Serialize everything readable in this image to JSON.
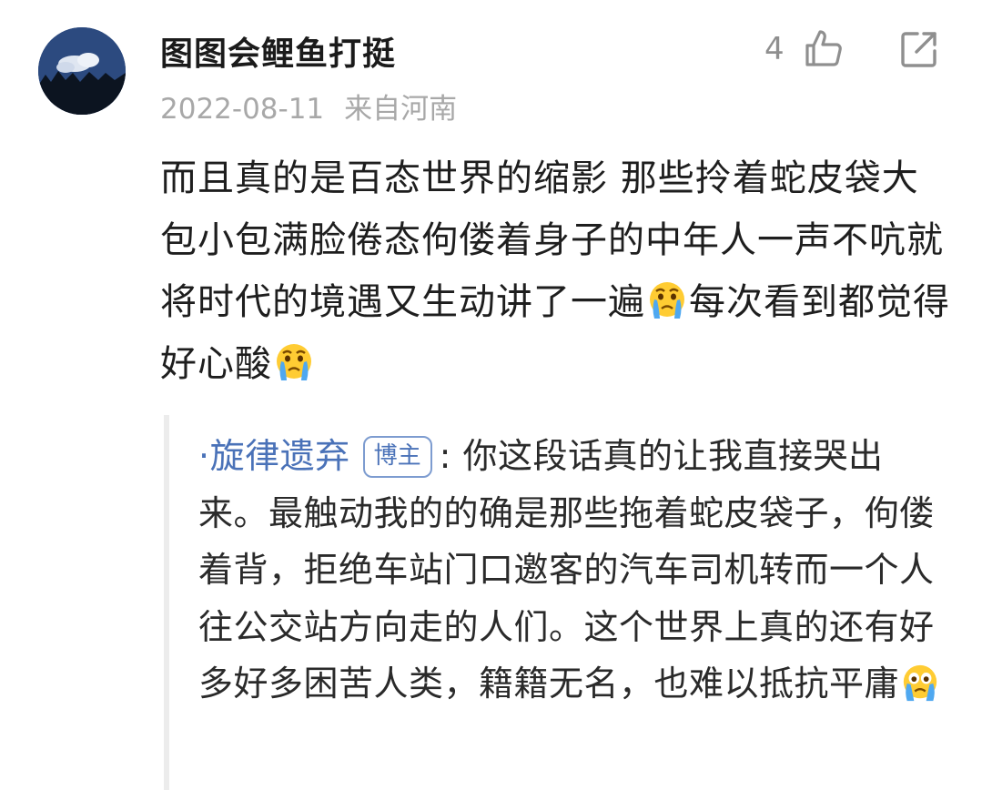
{
  "comment": {
    "username": "图图会鲤鱼打挺",
    "date": "2022-08-11",
    "location": "来自河南",
    "like_count": "4",
    "text_part1": "而且真的是百态世界的缩影 那些拎着蛇皮袋大包小包满脸倦态佝偻着身子的中年人一声不吭就将时代的境遇又生动讲了一遍",
    "text_part2": "每次看到都觉得好心酸",
    "emoji": "crying-face-emoji"
  },
  "reply": {
    "author": "·旋律遗弃",
    "badge": "博主",
    "separator": ":",
    "text": "你这段话真的让我直接哭出来。最触动我的的确是那些拖着蛇皮袋子，佝偻着背，拒绝车站门口邀客的汽车司机转而一个人往公交站方向走的人们。这个世界上真的还有好多好多困苦人类，籍籍无名，也难以抵抗平庸",
    "emoji": "crying-face-emoji"
  },
  "icons": {
    "like": "thumbs-up-icon",
    "share": "share-external-icon"
  },
  "colors": {
    "link": "#4a72b8",
    "meta": "#a8a8a8",
    "reply_bar": "#ececec"
  }
}
